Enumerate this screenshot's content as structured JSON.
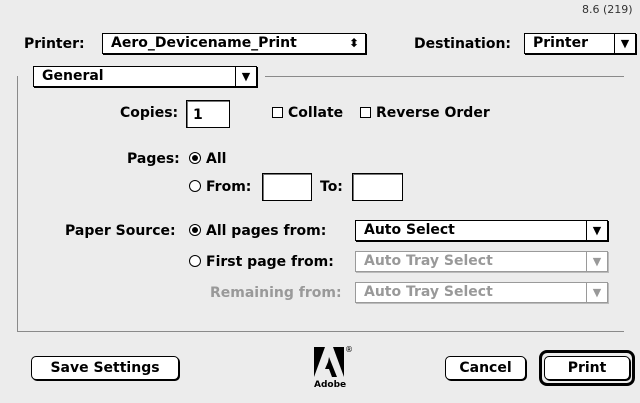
{
  "version": "8.6 (219)",
  "printer": {
    "label": "Printer:",
    "value": "Aero_Devicename_Print"
  },
  "destination": {
    "label": "Destination:",
    "value": "Printer"
  },
  "panel": {
    "selected": "General"
  },
  "copies": {
    "label": "Copies:",
    "value": "1"
  },
  "collate": {
    "label": "Collate",
    "checked": false
  },
  "reverse_order": {
    "label": "Reverse Order",
    "checked": false
  },
  "pages": {
    "label": "Pages:",
    "all_label": "All",
    "from_label": "From:",
    "to_label": "To:",
    "from_value": "",
    "to_value": "",
    "selected": "All"
  },
  "paper_source": {
    "label": "Paper Source:",
    "all_pages_label": "All pages from:",
    "all_pages_value": "Auto Select",
    "first_page_label": "First page from:",
    "first_page_value": "Auto Tray Select",
    "remaining_label": "Remaining from:",
    "remaining_value": "Auto Tray Select",
    "selected": "All pages from:"
  },
  "buttons": {
    "save_settings": "Save Settings",
    "cancel": "Cancel",
    "print": "Print"
  },
  "logo": {
    "text": "Adobe",
    "mark": "®"
  }
}
